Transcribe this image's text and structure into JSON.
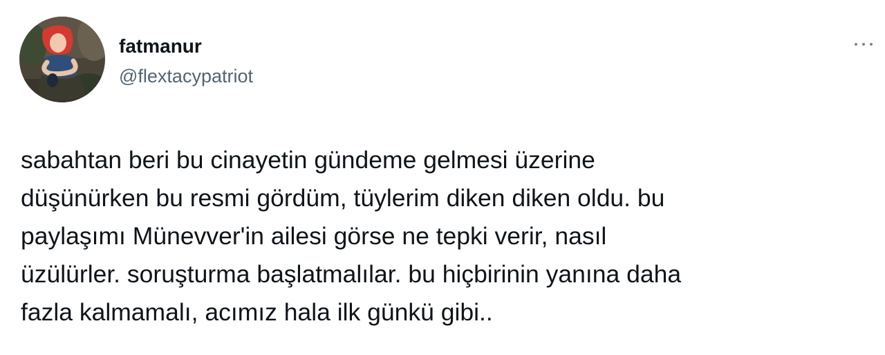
{
  "author": {
    "display_name": "fatmanur",
    "handle": "@flextacypatriot",
    "avatar_icon": "profile-photo-avatar"
  },
  "menu": {
    "icon": "more-options-icon"
  },
  "tweet": {
    "lines": [
      "sabahtan beri bu cinayetin gündeme gelmesi üzerine",
      "düşünürken bu resmi gördüm, tüylerim diken diken oldu. bu",
      "paylaşımı Münevver'in ailesi görse ne tepki verir, nasıl",
      "üzülürler. soruşturma başlatmalılar. bu hiçbirinin yanına daha",
      "fazla kalmamalı, acımız hala ilk günkü gibi.."
    ]
  },
  "colors": {
    "text_primary": "#0f1419",
    "text_secondary": "#536471",
    "background": "#ffffff"
  }
}
